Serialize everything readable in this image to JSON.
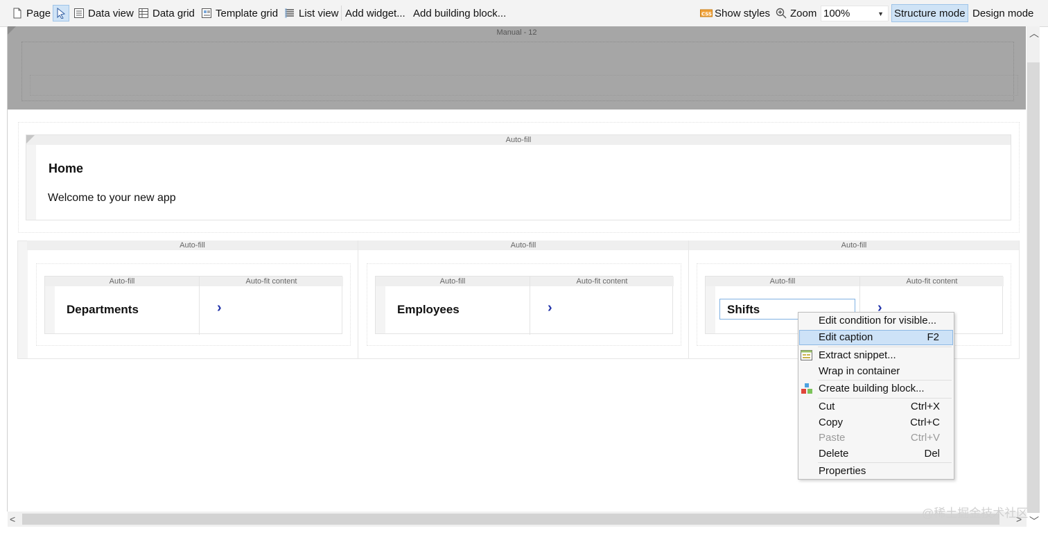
{
  "toolbar": {
    "page": "Page",
    "data_view": "Data view",
    "data_grid": "Data grid",
    "template_grid": "Template grid",
    "list_view": "List view",
    "add_widget": "Add widget...",
    "add_building_block": "Add building block...",
    "show_styles": "Show styles",
    "zoom_label": "Zoom",
    "zoom_value": "100%",
    "structure_mode": "Structure mode",
    "design_mode": "Design mode"
  },
  "layout": {
    "title": "Manual - 12"
  },
  "home": {
    "header": "Auto-fill",
    "title": "Home",
    "welcome": "Welcome to your new app"
  },
  "columns": [
    {
      "header": "Auto-fill",
      "left_header": "Auto-fill",
      "right_header": "Auto-fit content",
      "label": "Departments",
      "arrow": "›"
    },
    {
      "header": "Auto-fill",
      "left_header": "Auto-fill",
      "right_header": "Auto-fit content",
      "label": "Employees",
      "arrow": "›"
    },
    {
      "header": "Auto-fill",
      "left_header": "Auto-fill",
      "right_header": "Auto-fit content",
      "label": "Shifts",
      "arrow": "›"
    }
  ],
  "context_menu": {
    "items": [
      {
        "label": "Edit condition for visible...",
        "shortcut": ""
      },
      {
        "label": "Edit caption",
        "shortcut": "F2"
      },
      {
        "label": "Extract snippet...",
        "shortcut": ""
      },
      {
        "label": "Wrap in container",
        "shortcut": ""
      },
      {
        "label": "Create building block...",
        "shortcut": ""
      },
      {
        "label": "Cut",
        "shortcut": "Ctrl+X"
      },
      {
        "label": "Copy",
        "shortcut": "Ctrl+C"
      },
      {
        "label": "Paste",
        "shortcut": "Ctrl+V"
      },
      {
        "label": "Delete",
        "shortcut": "Del"
      },
      {
        "label": "Properties",
        "shortcut": ""
      }
    ]
  },
  "watermark": "@稀土掘金技术社区",
  "colors": {
    "selection": "#cde2f7",
    "link_arrow": "#2233aa",
    "layout_band": "#a6a6a6"
  },
  "icons": [
    "page-icon",
    "select-cursor-icon",
    "data-view-icon",
    "data-grid-icon",
    "template-grid-icon",
    "list-view-icon",
    "css-icon",
    "zoom-icon",
    "snippet-icon",
    "building-block-icon"
  ]
}
